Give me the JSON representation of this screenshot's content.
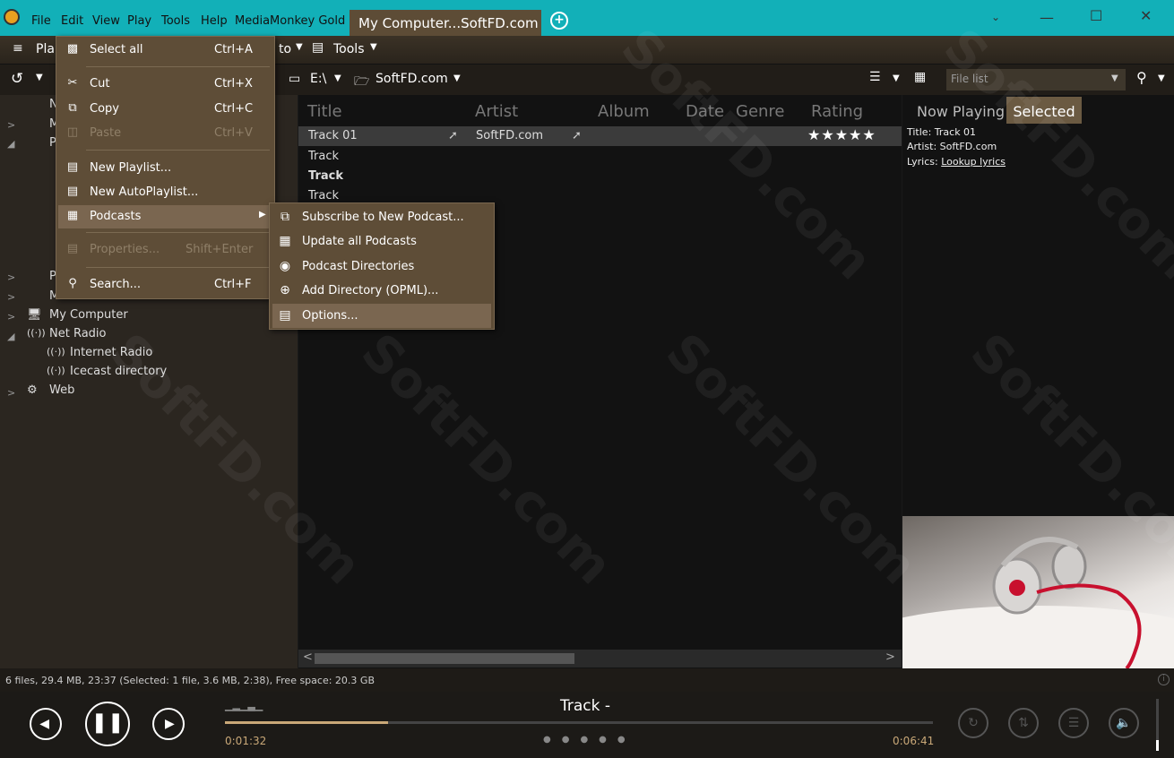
{
  "titlebar": {
    "menus": [
      "File",
      "Edit",
      "View",
      "Play",
      "Tools",
      "Help",
      "MediaMonkey Gold"
    ],
    "tab_title": "My Computer...SoftFD.com"
  },
  "toolbar": {
    "play_label": "Pla",
    "goto_label": "to",
    "tools_label": "Tools",
    "path_drive": "E:\\",
    "path_folder": "SoftFD.com",
    "filelist_placeholder": "File list"
  },
  "edit_menu": {
    "items": [
      {
        "label": "Select all",
        "shortcut": "Ctrl+A",
        "icon": "select-all-icon"
      },
      {
        "label": "Cut",
        "shortcut": "Ctrl+X",
        "icon": "cut-icon"
      },
      {
        "label": "Copy",
        "shortcut": "Ctrl+C",
        "icon": "copy-icon"
      },
      {
        "label": "Paste",
        "shortcut": "Ctrl+V",
        "icon": "paste-icon",
        "disabled": true
      },
      {
        "label": "New Playlist...",
        "shortcut": "",
        "icon": "new-playlist-icon"
      },
      {
        "label": "New AutoPlaylist...",
        "shortcut": "",
        "icon": "new-autoplaylist-icon"
      },
      {
        "label": "Podcasts",
        "shortcut": "",
        "icon": "podcasts-icon"
      },
      {
        "label": "Properties...",
        "shortcut": "Shift+Enter",
        "icon": "properties-icon",
        "disabled": true
      },
      {
        "label": "Search...",
        "shortcut": "Ctrl+F",
        "icon": "search-icon"
      }
    ]
  },
  "podcast_submenu": {
    "items": [
      {
        "label": "Subscribe to New Podcast...",
        "icon": "rss-icon"
      },
      {
        "label": "Update all Podcasts",
        "icon": "update-icon"
      },
      {
        "label": "Podcast Directories",
        "icon": "directory-icon"
      },
      {
        "label": "Add Directory (OPML)...",
        "icon": "add-directory-icon"
      },
      {
        "label": "Options...",
        "icon": "options-icon"
      }
    ]
  },
  "tree": {
    "items": [
      {
        "label": "N"
      },
      {
        "label": "M"
      },
      {
        "label": "P"
      },
      {
        "label": "P"
      },
      {
        "label": "M"
      },
      {
        "label": "My Computer"
      },
      {
        "label": "Net Radio"
      },
      {
        "label": "Internet Radio"
      },
      {
        "label": "Icecast directory"
      },
      {
        "label": "Web"
      }
    ]
  },
  "tracklist": {
    "columns": [
      "Title",
      "Artist",
      "Album",
      "Date",
      "Genre",
      "Rating"
    ],
    "rows": [
      {
        "title": "Track 01",
        "artist": "SoftFD.com",
        "rating": 4.5
      },
      {
        "title": "Track",
        "artist": "",
        "rating": 0
      },
      {
        "title": "Track",
        "artist": "",
        "rating": 0
      },
      {
        "title": "Track",
        "artist": "",
        "rating": 0
      }
    ]
  },
  "right_panel": {
    "tab_now_playing": "Now Playing",
    "tab_selected": "Selected",
    "title_label": "Title:",
    "title_value": "Track 01",
    "artist_label": "Artist:",
    "artist_value": "SoftFD.com",
    "lyrics_label": "Lyrics:",
    "lyrics_link": "Lookup lyrics"
  },
  "status": {
    "text": "6 files, 29.4 MB, 23:37 (Selected: 1 file, 3.6 MB, 2:38), Free space: 20.3 GB"
  },
  "player": {
    "track_title": "Track -",
    "elapsed": "0:01:32",
    "total": "0:06:41",
    "progress": 0.23,
    "volume": 0.2
  },
  "watermark": "SoftFD.com",
  "colors": {
    "titlebar": "#12b0b8",
    "menu_bg": "#5e4d37",
    "tab_selected": "#6b5a42"
  }
}
